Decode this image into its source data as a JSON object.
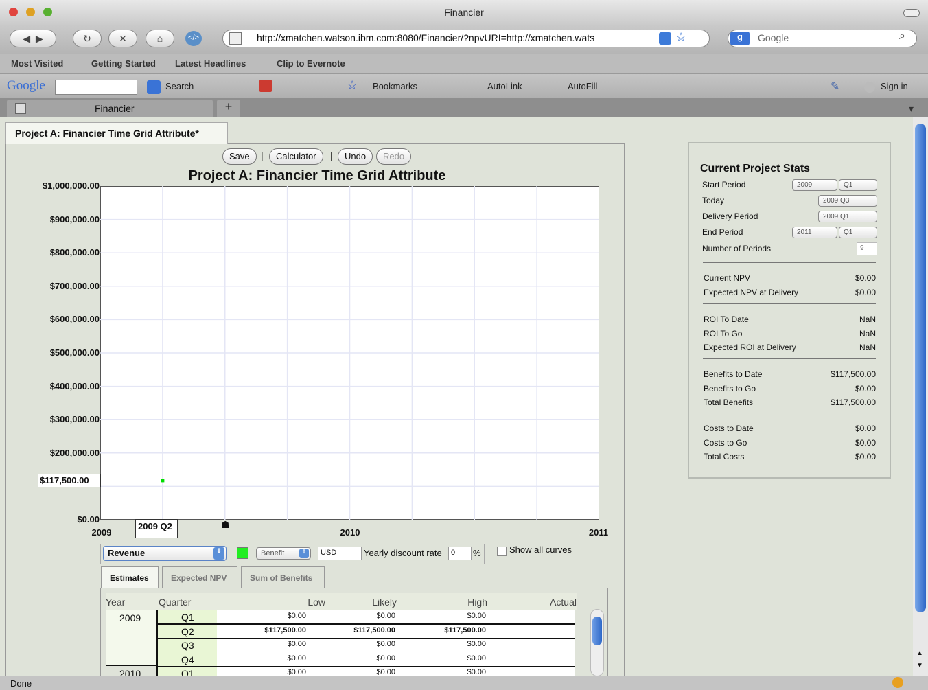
{
  "window": {
    "title": "Financier"
  },
  "nav": {
    "url": "http://xmatchen.watson.ibm.com:8080/Financier/?npvURI=http://xmatchen.wats",
    "search_placeholder": "Google"
  },
  "bookmarks": [
    "Most Visited",
    "Getting Started",
    "Latest Headlines",
    "Clip to Evernote"
  ],
  "google_toolbar": {
    "search": "Search",
    "bookmarks": "Bookmarks",
    "autolink": "AutoLink",
    "autofill": "AutoFill",
    "signin": "Sign in"
  },
  "browser_tab": {
    "label": "Financier",
    "new_tab": "+"
  },
  "page_tab": {
    "label": "Project A: Financier Time Grid Attribute*"
  },
  "toolbar": {
    "save": "Save",
    "calculator": "Calculator",
    "undo": "Undo",
    "redo": "Redo",
    "sep": "|"
  },
  "chart_data": {
    "type": "scatter",
    "title": "Project A: Financier Time Grid Attribute",
    "yticks": [
      "$1,000,000.00",
      "$900,000.00",
      "$800,000.00",
      "$700,000.00",
      "$600,000.00",
      "$500,000.00",
      "$400,000.00",
      "$300,000.00",
      "$200,000.00",
      "$0.00"
    ],
    "xticks": [
      "2009",
      "2010",
      "2011"
    ],
    "ylim": [
      0,
      1000000
    ],
    "series": [
      {
        "x": "2009 Q2",
        "y": 117500,
        "color": "#00dd00"
      }
    ],
    "hover_y_label": "$117,500.00",
    "hover_x_label": "2009 Q2",
    "grid": true
  },
  "controls": {
    "curve": "Revenue",
    "type": "Benefit",
    "currency": "USD",
    "discount_label": "Yearly discount rate",
    "discount": "0",
    "percent": "%",
    "show_all": "Show all curves",
    "swatch": "#22ee22"
  },
  "subtabs": [
    "Estimates",
    "Expected NPV",
    "Sum of Benefits"
  ],
  "table": {
    "headers": [
      "Year",
      "Quarter",
      "Low",
      "Likely",
      "High",
      "Actual"
    ],
    "rows": [
      {
        "year": "2009",
        "q": "Q1",
        "low": "$0.00",
        "likely": "$0.00",
        "high": "$0.00"
      },
      {
        "year": "",
        "q": "Q2",
        "low": "$117,500.00",
        "likely": "$117,500.00",
        "high": "$117,500.00"
      },
      {
        "year": "",
        "q": "Q3",
        "low": "$0.00",
        "likely": "$0.00",
        "high": "$0.00"
      },
      {
        "year": "",
        "q": "Q4",
        "low": "$0.00",
        "likely": "$0.00",
        "high": "$0.00"
      },
      {
        "year": "2010",
        "q": "Q1",
        "low": "$0.00",
        "likely": "$0.00",
        "high": "$0.00"
      }
    ]
  },
  "stats": {
    "title": "Current Project Stats",
    "start_label": "Start Period",
    "start_year": "2009",
    "start_q": "Q1",
    "today_label": "Today",
    "today": "2009 Q3",
    "delivery_label": "Delivery Period",
    "delivery": "2009 Q1",
    "end_label": "End Period",
    "end_year": "2011",
    "end_q": "Q1",
    "num_label": "Number of Periods",
    "num": "9",
    "groups": [
      [
        [
          "Current NPV",
          "$0.00"
        ],
        [
          "Expected NPV at Delivery",
          "$0.00"
        ]
      ],
      [
        [
          "ROI To Date",
          "NaN"
        ],
        [
          "ROI To Go",
          "NaN"
        ],
        [
          "Expected ROI at Delivery",
          "NaN"
        ]
      ],
      [
        [
          "Benefits to Date",
          "$117,500.00"
        ],
        [
          "Benefits to Go",
          "$0.00"
        ],
        [
          "Total Benefits",
          "$117,500.00"
        ]
      ],
      [
        [
          "Costs to Date",
          "$0.00"
        ],
        [
          "Costs to Go",
          "$0.00"
        ],
        [
          "Total Costs",
          "$0.00"
        ]
      ]
    ]
  },
  "status": {
    "text": "Done"
  }
}
